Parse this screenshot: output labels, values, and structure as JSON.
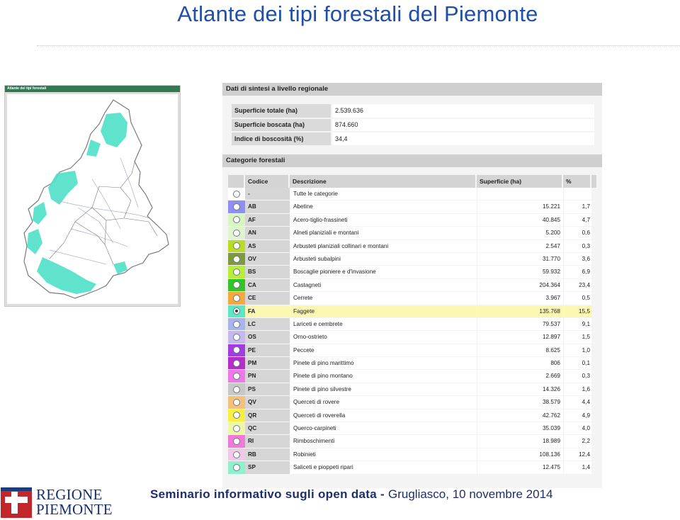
{
  "slide": {
    "title": "Atlante dei tipi forestali del Piemonte"
  },
  "map_panel": {
    "header": "Atlante dei tipi forestali"
  },
  "summary": {
    "header": "Dati di sintesi a livello regionale",
    "rows": [
      {
        "label": "Superficie totale (ha)",
        "value": "2.539.636"
      },
      {
        "label": "Superficie boscata (ha)",
        "value": "874.660"
      },
      {
        "label": "Indice di boscosità (%)",
        "value": "34,4"
      }
    ]
  },
  "categories": {
    "header": "Categorie forestali",
    "columns": {
      "code": "Codice",
      "desc": "Descrizione",
      "area": "Superficie (ha)",
      "pct": "%"
    },
    "rows": [
      {
        "code": "-",
        "desc": "Tutte le categorie",
        "area": "",
        "pct": "",
        "color": "#ffffff"
      },
      {
        "code": "AB",
        "desc": "Abetine",
        "area": "15.221",
        "pct": "1,7",
        "color": "#8f8ff0"
      },
      {
        "code": "AF",
        "desc": "Acero-tiglio-frassineti",
        "area": "40.845",
        "pct": "4,7",
        "color": "#d8f6c0"
      },
      {
        "code": "AN",
        "desc": "Alneti planiziali e montani",
        "area": "5.200",
        "pct": "0,6",
        "color": "#dff5d0"
      },
      {
        "code": "AS",
        "desc": "Arbusteti planiziali collinari e montani",
        "area": "2.547",
        "pct": "0,3",
        "color": "#b8dd22"
      },
      {
        "code": "OV",
        "desc": "Arbusteti subalpini",
        "area": "31.770",
        "pct": "3,6",
        "color": "#7f9a3c"
      },
      {
        "code": "BS",
        "desc": "Boscaglie pioniere e d'invasione",
        "area": "59.932",
        "pct": "6,9",
        "color": "#b6ee3a"
      },
      {
        "code": "CA",
        "desc": "Castagneti",
        "area": "204.364",
        "pct": "23,4",
        "color": "#32c42a"
      },
      {
        "code": "CE",
        "desc": "Cerrete",
        "area": "3.967",
        "pct": "0,5",
        "color": "#f5a93c"
      },
      {
        "code": "FA",
        "desc": "Faggete",
        "area": "135.768",
        "pct": "15,5",
        "color": "#58e8c4",
        "selected": true
      },
      {
        "code": "LC",
        "desc": "Lariceti e cembrete",
        "area": "79.537",
        "pct": "9,1",
        "color": "#a9b4ee"
      },
      {
        "code": "OS",
        "desc": "Orno-ostrieto",
        "area": "12.897",
        "pct": "1,5",
        "color": "#c4b8ee"
      },
      {
        "code": "PE",
        "desc": "Peccete",
        "area": "8.625",
        "pct": "1,0",
        "color": "#a23ce0"
      },
      {
        "code": "PM",
        "desc": "Pinete di pino marittimo",
        "area": "806",
        "pct": "0,1",
        "color": "#b62cc8"
      },
      {
        "code": "PN",
        "desc": "Pinete di pino montano",
        "area": "2.669",
        "pct": "0,3",
        "color": "#ee7ae8"
      },
      {
        "code": "PS",
        "desc": "Pinete di pino silvestre",
        "area": "14.326",
        "pct": "1,6",
        "color": "#c8c8c8"
      },
      {
        "code": "QV",
        "desc": "Querceti di rovere",
        "area": "38.579",
        "pct": "4,4",
        "color": "#f5c07a"
      },
      {
        "code": "QR",
        "desc": "Querceti di roverella",
        "area": "42.762",
        "pct": "4,9",
        "color": "#f8f040"
      },
      {
        "code": "QC",
        "desc": "Querco-carpineti",
        "area": "35.039",
        "pct": "4,0",
        "color": "#eef6a8"
      },
      {
        "code": "RI",
        "desc": "Rimboschimenti",
        "area": "18.989",
        "pct": "2,2",
        "color": "#f07ad8"
      },
      {
        "code": "RB",
        "desc": "Robinieti",
        "area": "108.136",
        "pct": "12,4",
        "color": "#f0c8e8"
      },
      {
        "code": "SP",
        "desc": "Saliceti e pioppeti ripari",
        "area": "12.475",
        "pct": "1,4",
        "color": "#8ff0cc"
      }
    ]
  },
  "logo": {
    "line1": "REGIONE",
    "line2": "PIEMONTE"
  },
  "footer": {
    "bold": "Seminario informativo sugli open data - ",
    "rest": "Grugliasco, 10 novembre 2014"
  }
}
